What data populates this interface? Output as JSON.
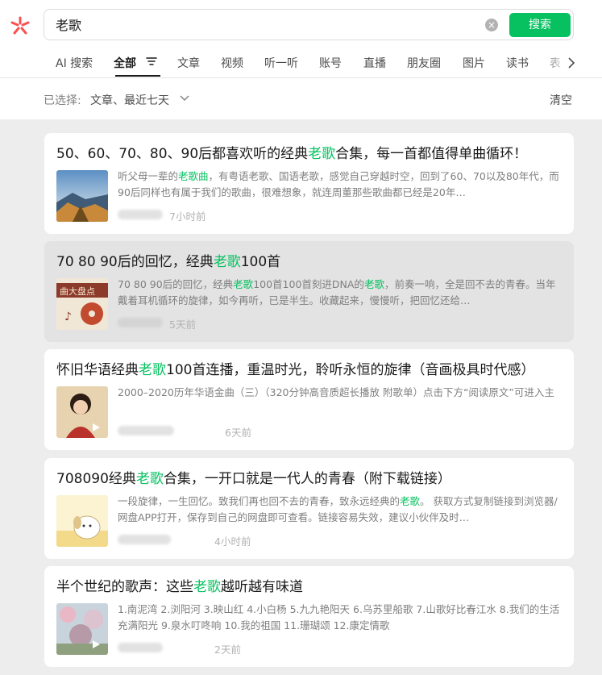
{
  "search": {
    "query": "老歌",
    "button_label": "搜索",
    "clear_icon": "close-circle-icon"
  },
  "tabs": [
    {
      "label": "AI 搜索"
    },
    {
      "label": "全部",
      "active": true
    },
    {
      "label": "文章"
    },
    {
      "label": "视频"
    },
    {
      "label": "听一听"
    },
    {
      "label": "账号"
    },
    {
      "label": "直播"
    },
    {
      "label": "朋友圈"
    },
    {
      "label": "图片"
    },
    {
      "label": "读书"
    },
    {
      "label": "表"
    }
  ],
  "filter": {
    "label": "已选择:",
    "value": "文章、最近七天",
    "clear_label": "清空"
  },
  "colors": {
    "accent": "#07c160",
    "logo": "#fa5151",
    "card_hover": "#e3e3e3"
  },
  "results": [
    {
      "title_pre": "50、60、70、80、90后都喜欢听的经典",
      "title_hl": "老歌",
      "title_post": "合集，每一首都值得单曲循环！",
      "snippet_pre": "听父母一辈的",
      "snippet_hl": "老歌曲",
      "snippet_post": "，有粤语老歌、国语老歌，感觉自己穿越时空，回到了60、70以及80年代，而90后同样也有属于我们的歌曲，很难想象，就连周董那些歌曲都已经是20年…",
      "time": "7小时前"
    },
    {
      "title_pre": "70 80 90后的回忆，经典",
      "title_hl": "老歌",
      "title_post": "100首",
      "snippet_pre": "70 80 90后的回忆，经典",
      "snippet_hl": "老歌",
      "snippet_mid": "100首100首刻进DNA的",
      "snippet_hl2": "老歌",
      "snippet_post": "，前奏一响，全是回不去的青春。当年戴着耳机循环的旋律，如今再听，已是半生。收藏起来，慢慢听，把回忆还给…",
      "thumb_text": "曲大盘点",
      "time": "5天前"
    },
    {
      "title_pre": "怀旧华语经典",
      "title_hl": "老歌",
      "title_post": "100首连播，重温时光，聆听永恒的旋律（音画极具时代感）",
      "snippet_pre": "2000–2020历年华语金曲（三）（320分钟高音质超长播放 附歌单）点击下方“阅读原文”可进入主",
      "time": "6天前"
    },
    {
      "title_pre": "708090经典",
      "title_hl": "老歌",
      "title_post": "合集，一开口就是一代人的青春（附下载链接）",
      "snippet_pre": "一段旋律，一生回忆。致我们再也回不去的青春，致永远经典的",
      "snippet_hl": "老歌",
      "snippet_post": "。 获取方式复制链接到浏览器/网盘APP打开，保存到自己的网盘即可查看。链接容易失效，建议小伙伴及时…",
      "time": "4小时前"
    },
    {
      "title_pre": "半个世纪的歌声：这些",
      "title_hl": "老歌",
      "title_post": "越听越有味道",
      "snippet_pre": "1.南泥湾 2.浏阳河 3.映山红 4.小白杨 5.九九艳阳天 6.乌苏里船歌 7.山歌好比春江水 8.我们的生活充满阳光 9.泉水叮咚响 10.我的祖国 11.珊瑚颂 12.康定情歌",
      "time": "2天前"
    }
  ]
}
